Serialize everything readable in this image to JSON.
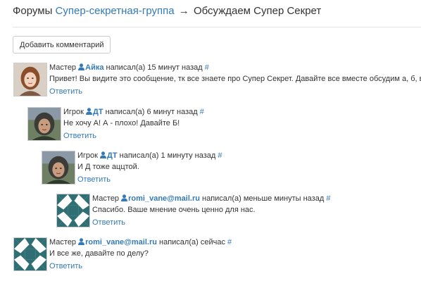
{
  "header": {
    "forums": "Форумы",
    "group": "Супер-секретная-группа",
    "arrow": "→",
    "topic": "Обсуждаем Супер Секрет"
  },
  "add_comment_label": "Добавить комментарий",
  "comments": [
    {
      "role": "Мастер",
      "user": "Айка",
      "wrote": "написал(а) 15 минут назад",
      "hash": "#",
      "text": "Привет! Вы видите это сообщение, тк все знаете про Супер Секрет. Давайте все вместе обсудим а, б, в и г.",
      "reply": "Ответить",
      "avatar": "photo-woman"
    },
    {
      "role": "Игрок",
      "user": "ДТ",
      "wrote": "написал(а) 6 минут назад",
      "hash": "#",
      "text": "Не хочу А! А - плохо! Давайте Б!",
      "reply": "Ответить",
      "avatar": "photo-woman-dark"
    },
    {
      "role": "Игрок",
      "user": "ДТ",
      "wrote": "написал(а) 1 минуту назад",
      "hash": "#",
      "text": "И Д тоже аццтой.",
      "reply": "Ответить",
      "avatar": "photo-woman-dark"
    },
    {
      "role": "Мастер",
      "user": "romi_vane@mail.ru",
      "wrote": "написал(а) меньше минуты назад",
      "hash": "#",
      "text": "Спасибо. Ваше мнение очень ценно для нас.",
      "reply": "Ответить",
      "avatar": "identicon-teal"
    },
    {
      "role": "Мастер",
      "user": "romi_vane@mail.ru",
      "wrote": "написал(а) сейчас",
      "hash": "#",
      "text": "И все же, давайте по делу?",
      "reply": "Ответить",
      "avatar": "identicon-teal"
    }
  ],
  "colors": {
    "link": "#337ab7",
    "identicon": "#2f6f74"
  }
}
